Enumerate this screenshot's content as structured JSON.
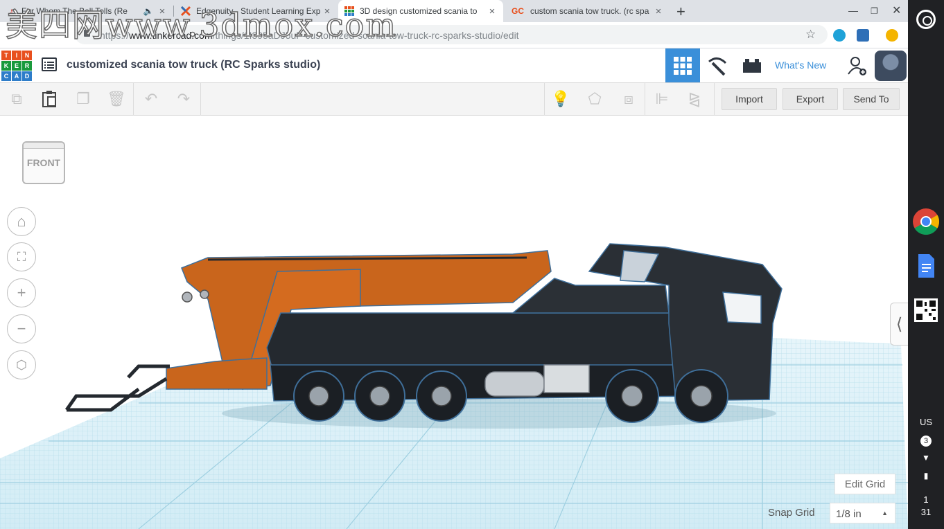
{
  "browser": {
    "tabs": [
      {
        "title": "For Whom The Bell Tolls (Re",
        "favicon": "music-note-icon",
        "sound": "speaker-icon"
      },
      {
        "title": "Edgenuity - Student Learning Exp",
        "favicon": "edgenuity-x-icon"
      },
      {
        "title": "3D design customized scania to",
        "favicon": "tinkercad-grid-icon",
        "active": true
      },
      {
        "title": "custom scania tow truck. (rc spa",
        "favicon_text": "GC"
      }
    ],
    "url_prefix": "https://",
    "url_host": "www.tinkercad.com",
    "url_path": "/things/1I395aDJ5uF-customized-scania-tow-truck-rc-sparks-studio/edit"
  },
  "watermark": "美四网www.3dmox.com",
  "app": {
    "logo_letters": [
      "T",
      "I",
      "N",
      "K",
      "E",
      "R",
      "C",
      "A",
      "D"
    ],
    "logo_colors": [
      "#e8501e",
      "#e8501e",
      "#e8501e",
      "#1a9a3c",
      "#1a9a3c",
      "#1a9a3c",
      "#2e7dc9",
      "#2e7dc9",
      "#2e7dc9"
    ],
    "design_title": "customized scania tow truck (RC Sparks studio)",
    "whats_new": "What's New",
    "accent_color": "#3a8fd9"
  },
  "toolbar": {
    "import_label": "Import",
    "export_label": "Export",
    "sendto_label": "Send To"
  },
  "workplane": {
    "viewcube_label": "FRONT",
    "edit_grid_label": "Edit Grid",
    "snap_grid_label": "Snap Grid",
    "snap_grid_value": "1/8 in",
    "grid_color": "#a9d7e6",
    "model_colors": {
      "boom": "#c9651c",
      "body": "#24292f",
      "edge": "#3f6f9a"
    }
  },
  "shelf": {
    "ime": "US",
    "notification_count": "3",
    "clock_hour": "1",
    "clock_min": "31"
  }
}
